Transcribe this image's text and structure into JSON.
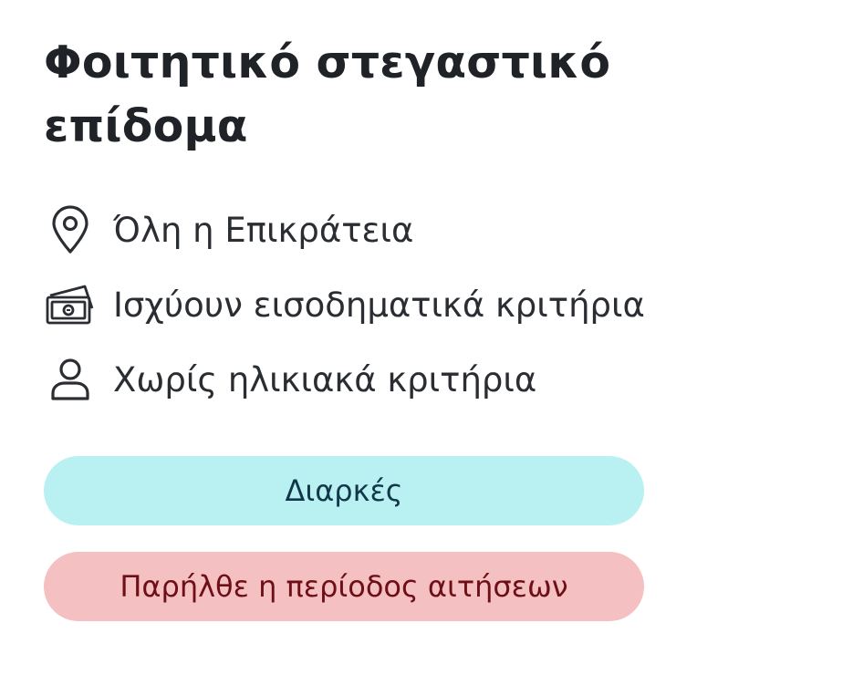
{
  "card": {
    "title": "Φοιτητικό στεγαστικό επίδομα",
    "facts": [
      {
        "icon": "location-pin-icon",
        "label": "Όλη η Επικράτεια"
      },
      {
        "icon": "money-icon",
        "label": "Ισχύουν εισοδηματικά κριτήρια"
      },
      {
        "icon": "person-icon",
        "label": "Χωρίς ηλικιακά κριτήρια"
      }
    ],
    "status_badge": "Διαρκές",
    "period_badge": "Παρήλθε η περίοδος αιτήσεων"
  },
  "colors": {
    "status_bg": "#b9f1f2",
    "status_text": "#12364a",
    "period_bg": "#f5c0c2",
    "period_text": "#6e0f17",
    "text": "#1f2327"
  }
}
